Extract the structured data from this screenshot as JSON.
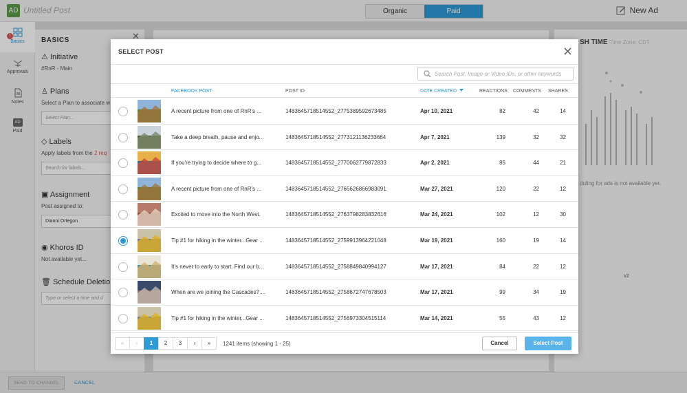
{
  "app": {
    "avatar": "AD",
    "title": "Untitled Post",
    "toggle": [
      "Organic",
      "Paid"
    ],
    "new_ad": "New Ad"
  },
  "rail": [
    {
      "label": "Basics",
      "icon": "grid-icon"
    },
    {
      "label": "Approvals",
      "icon": "approvals-icon"
    },
    {
      "label": "Notes",
      "icon": "notes-icon"
    },
    {
      "label": "Paid",
      "icon": "paid-icon",
      "badge": "AD"
    }
  ],
  "basics": {
    "heading": "BASICS",
    "initiative_label": "Initiative",
    "initiative_value": "#RnR - Main",
    "plans_label": "Plans",
    "plans_help": "Select a Plan to associate w post",
    "plans_placeholder": "Select Plan...",
    "labels_label": "Labels",
    "labels_help": "Apply labels from the",
    "labels_req": "2 req",
    "labels_placeholder": "Search for labels...",
    "assignment_label": "Assignment",
    "assignment_help": "Post assigned to:",
    "assignment_value": "Dianni Ortegon",
    "khoros_label": "Khoros ID",
    "khoros_value": "Not available yet...",
    "deletion_label": "Schedule Deletion",
    "deletion_placeholder": "Type or select a time and d"
  },
  "right": {
    "publish_title": "SH TIME",
    "timezone": "Time Zone: CDT",
    "schedule_note": "duling for ads is not available yet.",
    "vz": "vz"
  },
  "bottom": {
    "send": "SEND TO CHANNEL",
    "cancel": "CANCEL"
  },
  "modal": {
    "title": "SELECT POST",
    "search_placeholder": "Search Post, Image or Video IDs, or other keywords",
    "headers": {
      "post": "FACEBOOK POST",
      "id": "POST ID",
      "date": "DATE CREATED",
      "reactions": "REACTIONS",
      "comments": "COMMENTS",
      "shares": "SHARES"
    },
    "rows": [
      {
        "text": "A recent picture from one of RnR's ...",
        "id": "1483645718514552_2775389592673485",
        "date": "Apr 10, 2021",
        "reactions": "82",
        "comments": "42",
        "shares": "14",
        "selected": false
      },
      {
        "text": "Take a deep breath, pause and enjo...",
        "id": "1483645718514552_2773121136233664",
        "date": "Apr 7, 2021",
        "reactions": "139",
        "comments": "32",
        "shares": "32",
        "selected": false
      },
      {
        "text": "If you're trying to decide where to g...",
        "id": "1483645718514552_2770062779872833",
        "date": "Apr 2, 2021",
        "reactions": "85",
        "comments": "44",
        "shares": "21",
        "selected": false
      },
      {
        "text": "A recent picture from one of RnR's ...",
        "id": "1483645718514552_2765626866983091",
        "date": "Mar 27, 2021",
        "reactions": "120",
        "comments": "22",
        "shares": "12",
        "selected": false
      },
      {
        "text": "Excited to move into the North West.",
        "id": "1483645718514552_2763798283832616",
        "date": "Mar 24, 2021",
        "reactions": "102",
        "comments": "12",
        "shares": "30",
        "selected": false
      },
      {
        "text": "Tip #1 for hiking in the winter...Gear ...",
        "id": "1483645718514552_2759913964221048",
        "date": "Mar 19, 2021",
        "reactions": "160",
        "comments": "19",
        "shares": "14",
        "selected": true
      },
      {
        "text": "It's never to early to start. Find our b...",
        "id": "1483645718514552_2758849840994127",
        "date": "Mar 17, 2021",
        "reactions": "84",
        "comments": "22",
        "shares": "12",
        "selected": false
      },
      {
        "text": "When are we joining the Cascades? ...",
        "id": "1483645718514552_2758672747678503",
        "date": "Mar 17, 2021",
        "reactions": "99",
        "comments": "34",
        "shares": "19",
        "selected": false
      },
      {
        "text": "Tip #1 for hiking in the winter...Gear ...",
        "id": "1483645718514552_2756973304515114",
        "date": "Mar 14, 2021",
        "reactions": "55",
        "comments": "43",
        "shares": "12",
        "selected": false
      }
    ],
    "pagination": {
      "first": "«",
      "prev": "‹",
      "pages": [
        "1",
        "2",
        "3"
      ],
      "next": "›",
      "last": "»",
      "current": "1",
      "info": "1241 items (showing 1 - 25)"
    },
    "cancel_label": "Cancel",
    "select_label": "Select Post"
  },
  "colors": {
    "accent": "#2f9ad8",
    "select_button": "#5ab4ea",
    "paid_toggle": "#2f9ad8",
    "error_badge": "#d9534f"
  }
}
